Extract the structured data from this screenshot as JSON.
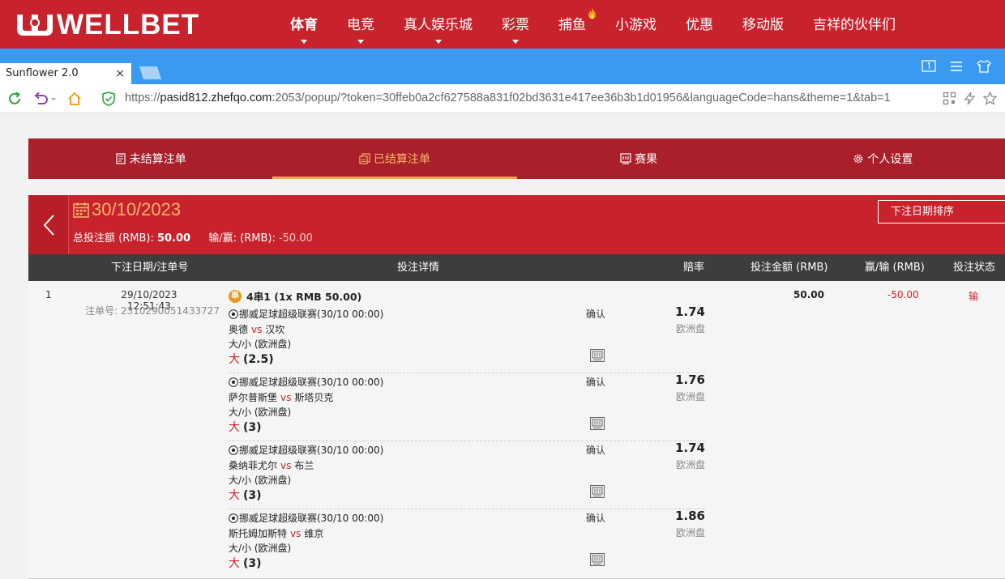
{
  "site": {
    "logo_text": "WELLBET",
    "nav": [
      {
        "label": "体育",
        "caret": true,
        "active": true
      },
      {
        "label": "电竞",
        "caret": true
      },
      {
        "label": "真人娱乐城",
        "caret": true
      },
      {
        "label": "彩票",
        "caret": true
      },
      {
        "label": "捕鱼",
        "caret": false,
        "hot": true
      },
      {
        "label": "小游戏",
        "caret": false
      },
      {
        "label": "优惠",
        "caret": false
      },
      {
        "label": "移动版",
        "caret": false
      },
      {
        "label": "吉祥的伙伴们",
        "caret": false
      }
    ]
  },
  "browser": {
    "tab_title": "Sunflower 2.0",
    "tab_close": "×",
    "url_scheme": "https://",
    "url_host": "pasid812.zhefqo.com",
    "url_rest": ":2053/popup/?token=30ffeb0a2cf627588a831f02bd3631e417ee36b3b1d01956&languageCode=hans&theme=1&tab=1"
  },
  "page_tabs": [
    {
      "label": "未结算注单",
      "icon": "receipt-icon"
    },
    {
      "label": "已结算注单",
      "icon": "copy-icon",
      "active": true
    },
    {
      "label": "赛果",
      "icon": "scoreboard-icon"
    },
    {
      "label": "个人设置",
      "icon": "gear-icon"
    }
  ],
  "date_header": {
    "date": "30/10/2023",
    "total_label": "总投注额 (RMB):",
    "total_value": "50.00",
    "winloss_label": "输/赢: (RMB):",
    "winloss_value": "-50.00",
    "sort_label": "下注日期排序"
  },
  "table_headers": {
    "date_no": "下注日期/注单号",
    "details": "投注详情",
    "odds": "赔率",
    "stake": "投注金额 (RMB)",
    "winloss": "赢/输 (RMB)",
    "status": "投注状态"
  },
  "bet": {
    "index": "1",
    "datetime": "29/10/2023 12:51:43",
    "bet_no_label": "注单号:",
    "bet_no": "2310290051433727",
    "combo_badge": "串",
    "combo_label": "4串1 (1x RMB 50.00)",
    "stake": "50.00",
    "winloss": "-50.00",
    "status": "输",
    "legs": [
      {
        "league": "挪威足球超级联赛(30/10 00:00)",
        "home": "奥德",
        "vs": "vs",
        "away": "汉坎",
        "market": "大/小 (欧洲盘)",
        "side": "大",
        "line": "(2.5)",
        "confirm": "确认",
        "odds": "1.74",
        "odds_type": "欧洲盘"
      },
      {
        "league": "挪威足球超级联赛(30/10 00:00)",
        "home": "萨尔普斯堡",
        "vs": "vs",
        "away": "斯塔贝克",
        "market": "大/小 (欧洲盘)",
        "side": "大",
        "line": "(3)",
        "confirm": "确认",
        "odds": "1.76",
        "odds_type": "欧洲盘"
      },
      {
        "league": "挪威足球超级联赛(30/10 00:00)",
        "home": "桑纳菲尤尔",
        "vs": "vs",
        "away": "布兰",
        "market": "大/小 (欧洲盘)",
        "side": "大",
        "line": "(3)",
        "confirm": "确认",
        "odds": "1.74",
        "odds_type": "欧洲盘"
      },
      {
        "league": "挪威足球超级联赛(30/10 00:00)",
        "home": "斯托姆加斯特",
        "vs": "vs",
        "away": "维京",
        "market": "大/小 (欧洲盘)",
        "side": "大",
        "line": "(3)",
        "confirm": "确认",
        "odds": "1.86",
        "odds_type": "欧洲盘"
      }
    ]
  },
  "colors": {
    "brand_red": "#c8232c",
    "tab_red": "#a91f2a",
    "accent_orange": "#f6b46c",
    "browser_blue": "#3a9af1"
  }
}
